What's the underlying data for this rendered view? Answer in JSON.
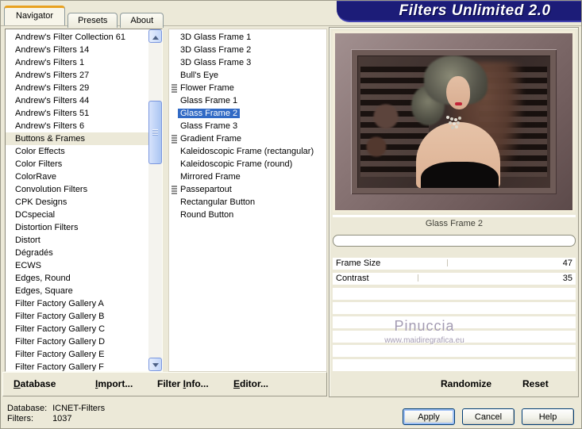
{
  "app": {
    "title": "Filters Unlimited 2.0"
  },
  "tabs": [
    {
      "label": "Navigator",
      "selected": true
    },
    {
      "label": "Presets"
    },
    {
      "label": "About"
    }
  ],
  "categories": {
    "items": [
      {
        "label": "Andrew's Filter Collection 61"
      },
      {
        "label": "Andrew's Filters 14"
      },
      {
        "label": "Andrew's Filters 1"
      },
      {
        "label": "Andrew's Filters 27"
      },
      {
        "label": "Andrew's Filters 29"
      },
      {
        "label": "Andrew's Filters 44"
      },
      {
        "label": "Andrew's Filters 51"
      },
      {
        "label": "Andrew's Filters 6"
      },
      {
        "label": "Buttons & Frames",
        "selected": true
      },
      {
        "label": "Color Effects"
      },
      {
        "label": "Color Filters"
      },
      {
        "label": "ColorRave"
      },
      {
        "label": "Convolution Filters"
      },
      {
        "label": "CPK Designs"
      },
      {
        "label": "DCspecial"
      },
      {
        "label": "Distortion Filters"
      },
      {
        "label": "Distort"
      },
      {
        "label": "Dégradés"
      },
      {
        "label": "ECWS"
      },
      {
        "label": "Edges, Round"
      },
      {
        "label": "Edges, Square"
      },
      {
        "label": "Filter Factory Gallery A"
      },
      {
        "label": "Filter Factory Gallery B"
      },
      {
        "label": "Filter Factory Gallery C"
      },
      {
        "label": "Filter Factory Gallery D"
      },
      {
        "label": "Filter Factory Gallery E"
      },
      {
        "label": "Filter Factory Gallery F"
      }
    ]
  },
  "filters": {
    "items": [
      {
        "label": "3D Glass Frame 1"
      },
      {
        "label": "3D Glass Frame 2"
      },
      {
        "label": "3D Glass Frame 3"
      },
      {
        "label": "Bull's Eye"
      },
      {
        "label": "Flower Frame",
        "has_icon": true
      },
      {
        "label": "Glass Frame 1"
      },
      {
        "label": "Glass Frame 2",
        "selected": true
      },
      {
        "label": "Glass Frame 3"
      },
      {
        "label": "Gradient Frame",
        "has_icon": true
      },
      {
        "label": "Kaleidoscopic Frame (rectangular)"
      },
      {
        "label": "Kaleidoscopic Frame (round)"
      },
      {
        "label": "Mirrored Frame"
      },
      {
        "label": "Passepartout",
        "has_icon": true
      },
      {
        "label": "Rectangular Button"
      },
      {
        "label": "Round Button"
      }
    ]
  },
  "preview": {
    "caption": "Glass Frame 2",
    "progress_percent": 0
  },
  "sliders": {
    "rows": [
      {
        "label": "Frame Size",
        "value": "47"
      },
      {
        "label": "Contrast",
        "value": "35"
      },
      {},
      {},
      {},
      {},
      {},
      {}
    ]
  },
  "watermark": {
    "name": "Pinuccia",
    "url": "www.maidiregrafica.eu"
  },
  "toolbar": {
    "database": {
      "mn": "D",
      "post": "atabase"
    },
    "import_": {
      "mn": "I",
      "post": "mport..."
    },
    "filter_info": {
      "pre": "Filter ",
      "mn": "I",
      "post": "nfo..."
    },
    "editor": {
      "mn": "E",
      "post": "ditor..."
    },
    "randomize": "Randomize",
    "reset": "Reset"
  },
  "status": {
    "database_label": "Database:",
    "database_value": "ICNET-Filters",
    "filters_label": "Filters:",
    "filters_value": "1037"
  },
  "actions": {
    "apply": "Apply",
    "cancel": "Cancel",
    "help": "Help"
  },
  "colors": {
    "window_bg": "#ece9d8",
    "banner_navy": "#1c1c78",
    "selection_blue": "#316ac5",
    "tab_accent_orange": "#e8a120"
  }
}
